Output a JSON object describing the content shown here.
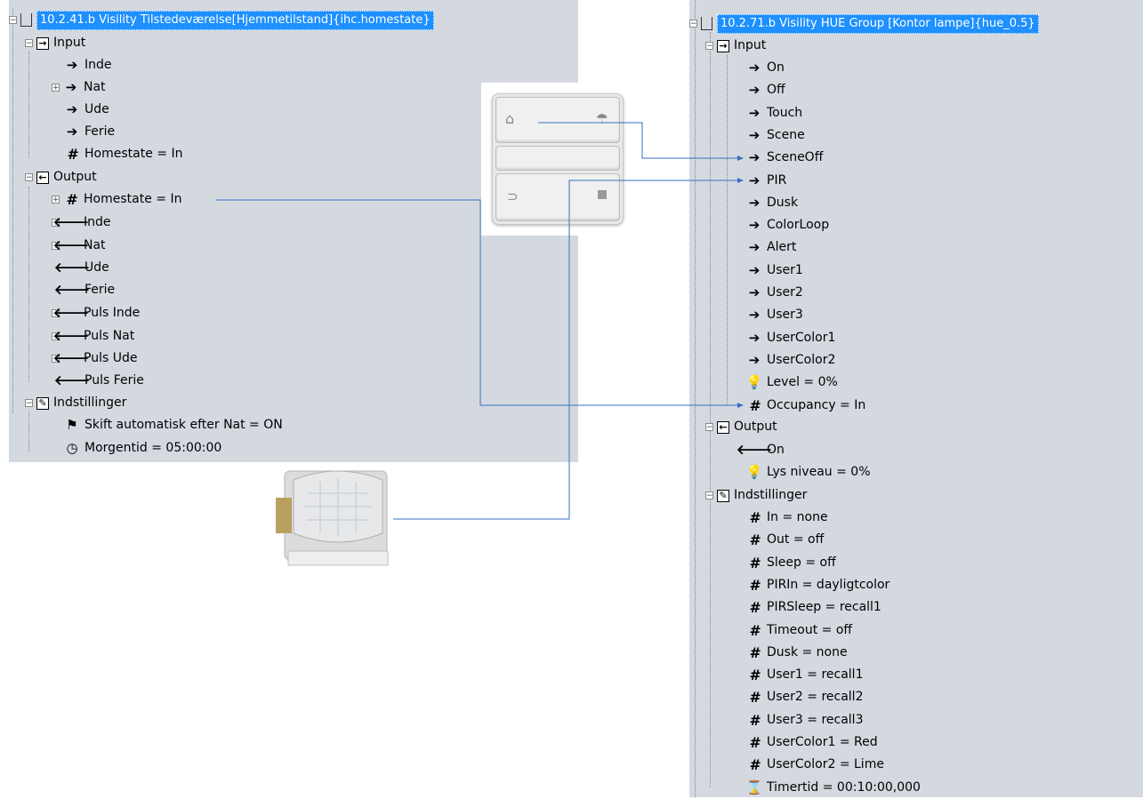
{
  "left_tree": {
    "root_label": "10.2.41.b Visility Tilstedeværelse[Hjemmetilstand]{ihc.homestate}",
    "input_label": "Input",
    "inputs": [
      "Inde",
      "Nat",
      "Ude",
      "Ferie",
      "Homestate = In"
    ],
    "output_label": "Output",
    "outputs": [
      "Homestate = In",
      "Inde",
      "Nat",
      "Ude",
      "Ferie",
      "Puls Inde",
      "Puls Nat",
      "Puls Ude",
      "Puls Ferie"
    ],
    "settings_label": "Indstillinger",
    "settings": [
      "Skift automatisk efter Nat = ON",
      "Morgentid = 05:00:00"
    ]
  },
  "right_tree": {
    "root_label": "10.2.71.b Visility HUE Group [Kontor lampe]{hue_0.5}",
    "input_label": "Input",
    "inputs": [
      "On",
      "Off",
      "Touch",
      "Scene",
      "SceneOff",
      "PIR",
      "Dusk",
      "ColorLoop",
      "Alert",
      "User1",
      "User2",
      "User3",
      "UserColor1",
      "UserColor2",
      "Level = 0%",
      "Occupancy = In"
    ],
    "output_label": "Output",
    "outputs": [
      "On",
      "Lys niveau = 0%"
    ],
    "settings_label": "Indstillinger",
    "settings": [
      "In = none",
      "Out = off",
      "Sleep = off",
      "PIRIn = dayligtcolor",
      "PIRSleep = recall1",
      "Timeout = off",
      "Dusk = none",
      "User1 = recall1",
      "User2 = recall2",
      "User3 = recall3",
      "UserColor1 = Red",
      "UserColor2 = Lime",
      "Timertid = 00:10:00,000"
    ]
  },
  "colors": {
    "panel_bg": "#d4d9e0",
    "selection": "#1e90ff",
    "connector": "#3a6fbf"
  }
}
